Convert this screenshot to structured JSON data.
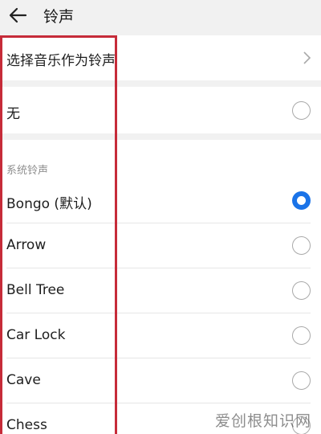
{
  "header": {
    "title": "铃声"
  },
  "choose_music": {
    "label": "选择音乐作为铃声"
  },
  "none_option": {
    "label": "无",
    "selected": false
  },
  "system_section": {
    "label": "系统铃声"
  },
  "ringtones": [
    {
      "label": "Bongo (默认)",
      "selected": true
    },
    {
      "label": "Arrow",
      "selected": false
    },
    {
      "label": "Bell Tree",
      "selected": false
    },
    {
      "label": "Car Lock",
      "selected": false
    },
    {
      "label": "Cave",
      "selected": false
    },
    {
      "label": "Chess",
      "selected": false
    }
  ],
  "watermark": {
    "text": "爱创根知识网"
  },
  "colors": {
    "accent": "#1a73e8",
    "highlight_box": "#c62b39"
  }
}
